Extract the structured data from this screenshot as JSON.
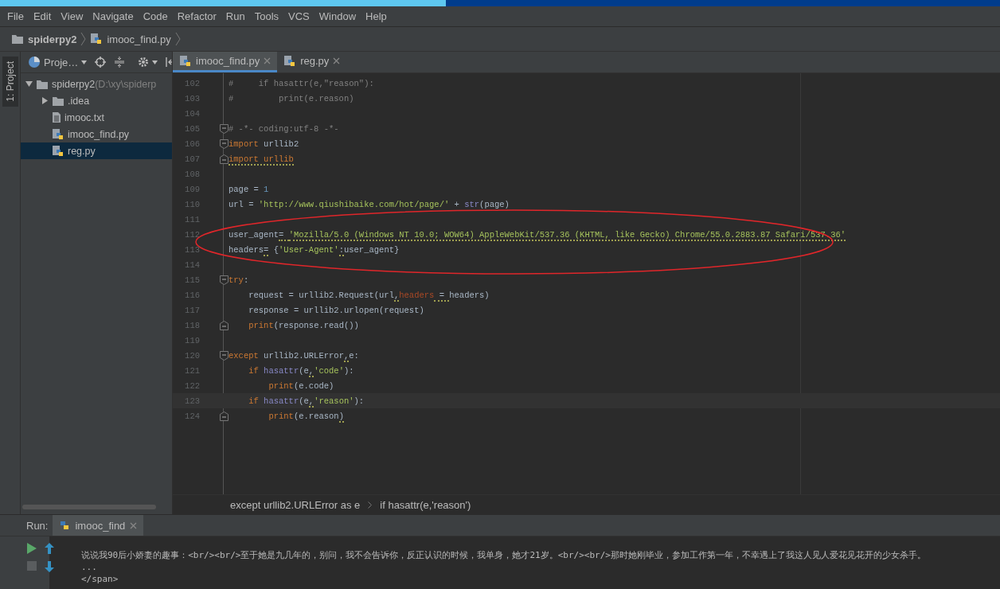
{
  "menu": [
    "File",
    "Edit",
    "View",
    "Navigate",
    "Code",
    "Refactor",
    "Run",
    "Tools",
    "VCS",
    "Window",
    "Help"
  ],
  "navigation": [
    {
      "kind": "folder",
      "label": "spiderpy2"
    },
    {
      "kind": "python",
      "label": "imooc_find.py"
    }
  ],
  "tool_stripe": {
    "label": "1: Project"
  },
  "project": {
    "title": "Proje…",
    "tree": [
      {
        "kind": "folder",
        "label": "spiderpy2",
        "path": "(D:\\xy\\spiderp",
        "expanded": true,
        "selected": false,
        "children": [
          {
            "kind": "folder",
            "label": ".idea",
            "expanded": false,
            "selected": false
          },
          {
            "kind": "text",
            "label": "imooc.txt",
            "selected": false
          },
          {
            "kind": "python",
            "label": "imooc_find.py",
            "selected": false
          },
          {
            "kind": "python",
            "label": "reg.py",
            "selected": true
          }
        ]
      }
    ]
  },
  "tabs": [
    {
      "label": "imooc_find.py",
      "selected": true
    },
    {
      "label": "reg.py",
      "selected": false
    }
  ],
  "code": [
    {
      "number": "102",
      "fold_start": false,
      "fold_end": false,
      "current": false,
      "tokens": [
        {
          "kind": "comment",
          "text": "#     if hasattr(e,\"reason\"):"
        }
      ]
    },
    {
      "number": "103",
      "fold_start": false,
      "fold_end": false,
      "current": false,
      "tokens": [
        {
          "kind": "comment",
          "text": "#         print(e.reason)"
        }
      ]
    },
    {
      "number": "104",
      "fold_start": false,
      "fold_end": false,
      "current": false
    },
    {
      "number": "105",
      "fold_start": true,
      "fold_end": false,
      "current": false,
      "tokens": [
        {
          "kind": "comment",
          "text": "# -*- coding:utf-8 -*-"
        }
      ]
    },
    {
      "number": "106",
      "fold_start": true,
      "fold_end": false,
      "current": false,
      "tokens": [
        {
          "kind": "keyword",
          "text": "import"
        },
        {
          "kind": "plain",
          "text": " urllib2"
        }
      ]
    },
    {
      "number": "107",
      "fold_start": false,
      "fold_end": true,
      "current": false,
      "tokens": [
        {
          "kind": "keyword",
          "text": "import urllib",
          "warning": true
        }
      ]
    },
    {
      "number": "108",
      "fold_start": false,
      "fold_end": false,
      "current": false
    },
    {
      "number": "109",
      "fold_start": false,
      "fold_end": false,
      "current": false,
      "tokens": [
        {
          "kind": "plain",
          "text": "page = "
        },
        {
          "kind": "number",
          "text": "1"
        }
      ]
    },
    {
      "number": "110",
      "fold_start": false,
      "fold_end": false,
      "current": false,
      "tokens": [
        {
          "kind": "plain",
          "text": "url = "
        },
        {
          "kind": "string",
          "text": "'http://www.qiushibaike.com/hot/page/'"
        },
        {
          "kind": "plain",
          "text": " + "
        },
        {
          "kind": "builtin",
          "text": "str"
        },
        {
          "kind": "plain",
          "text": "(page)"
        }
      ]
    },
    {
      "number": "111",
      "fold_start": false,
      "fold_end": false,
      "current": false
    },
    {
      "number": "112",
      "fold_start": false,
      "fold_end": false,
      "current": false,
      "tokens": [
        {
          "kind": "plain",
          "text": "user_agent"
        },
        {
          "kind": "plain",
          "text": "= ",
          "warning": true
        },
        {
          "kind": "string",
          "text": "'Mozilla/5.0 (Windows NT 10.0; WOW64) AppleWebKit/537.36 (KHTML, like Gecko) Chrome/55.0.2883.87 Safari/537.36'",
          "warning": true
        }
      ]
    },
    {
      "number": "113",
      "fold_start": false,
      "fold_end": false,
      "current": false,
      "tokens": [
        {
          "kind": "plain",
          "text": "headers"
        },
        {
          "kind": "plain",
          "text": "=",
          "warning": true
        },
        {
          "kind": "plain",
          "text": " {"
        },
        {
          "kind": "string",
          "text": "'User-Agent'"
        },
        {
          "kind": "plain",
          "text": ":",
          "warning": true
        },
        {
          "kind": "plain",
          "text": "user_agent}"
        }
      ]
    },
    {
      "number": "114",
      "fold_start": false,
      "fold_end": false,
      "current": false
    },
    {
      "number": "115",
      "fold_start": true,
      "fold_end": false,
      "current": false,
      "tokens": [
        {
          "kind": "keyword",
          "text": "try"
        },
        {
          "kind": "plain",
          "text": ":"
        }
      ]
    },
    {
      "number": "116",
      "fold_start": false,
      "fold_end": false,
      "current": false,
      "tokens": [
        {
          "kind": "plain",
          "text": "    request = urllib2.Request(url"
        },
        {
          "kind": "plain",
          "text": ",",
          "warning": true
        },
        {
          "kind": "parameter",
          "text": "headers"
        },
        {
          "kind": "plain",
          "text": " = ",
          "warning": true
        },
        {
          "kind": "plain",
          "text": "headers)"
        }
      ]
    },
    {
      "number": "117",
      "fold_start": false,
      "fold_end": false,
      "current": false,
      "tokens": [
        {
          "kind": "plain",
          "text": "    response = urllib2.urlopen(request)"
        }
      ]
    },
    {
      "number": "118",
      "fold_start": false,
      "fold_end": true,
      "current": false,
      "tokens": [
        {
          "kind": "keyword",
          "text": "    print"
        },
        {
          "kind": "plain",
          "text": "(response.read())"
        }
      ]
    },
    {
      "number": "119",
      "fold_start": false,
      "fold_end": false,
      "current": false
    },
    {
      "number": "120",
      "fold_start": true,
      "fold_end": false,
      "current": false,
      "tokens": [
        {
          "kind": "keyword",
          "text": "except"
        },
        {
          "kind": "plain",
          "text": " urllib2.URLError"
        },
        {
          "kind": "plain",
          "text": ",",
          "warning": true
        },
        {
          "kind": "plain",
          "text": "e:"
        }
      ]
    },
    {
      "number": "121",
      "fold_start": false,
      "fold_end": false,
      "current": false,
      "tokens": [
        {
          "kind": "keyword",
          "text": "    if "
        },
        {
          "kind": "builtin",
          "text": "hasattr"
        },
        {
          "kind": "plain",
          "text": "(e"
        },
        {
          "kind": "plain",
          "text": ",",
          "warning": true
        },
        {
          "kind": "string",
          "text": "'code'"
        },
        {
          "kind": "plain",
          "text": "):"
        }
      ]
    },
    {
      "number": "122",
      "fold_start": false,
      "fold_end": false,
      "current": false,
      "tokens": [
        {
          "kind": "keyword",
          "text": "        print"
        },
        {
          "kind": "plain",
          "text": "(e.code)"
        }
      ]
    },
    {
      "number": "123",
      "fold_start": false,
      "fold_end": false,
      "current": true,
      "tokens": [
        {
          "kind": "keyword",
          "text": "    if "
        },
        {
          "kind": "builtin",
          "text": "hasattr"
        },
        {
          "kind": "plain",
          "text": "(e"
        },
        {
          "kind": "plain",
          "text": ",",
          "warning": true
        },
        {
          "kind": "string",
          "text": "'reason'"
        },
        {
          "kind": "plain",
          "text": "):"
        }
      ]
    },
    {
      "number": "124",
      "fold_start": false,
      "fold_end": true,
      "current": false,
      "tokens": [
        {
          "kind": "keyword",
          "text": "        print"
        },
        {
          "kind": "plain",
          "text": "(e.reason"
        },
        {
          "kind": "plain",
          "text": ")",
          "warning": true
        }
      ]
    }
  ],
  "breadcrumbs": [
    "except urllib2.URLError as e",
    "if hasattr(e,'reason')"
  ],
  "run": {
    "label": "Run:",
    "tab": "imooc_find",
    "output": [
      "说说我90后小娇妻的趣事：<br/><br/>至于她是九几年的，别问，我不会告诉你，反正认识的时候，我单身，她才21岁。<br/><br/>那时她刚毕业，参加工作第一年，不幸遇上了我这人见人爱花见花开的少女杀手。",
      "...",
      "</span>"
    ]
  }
}
